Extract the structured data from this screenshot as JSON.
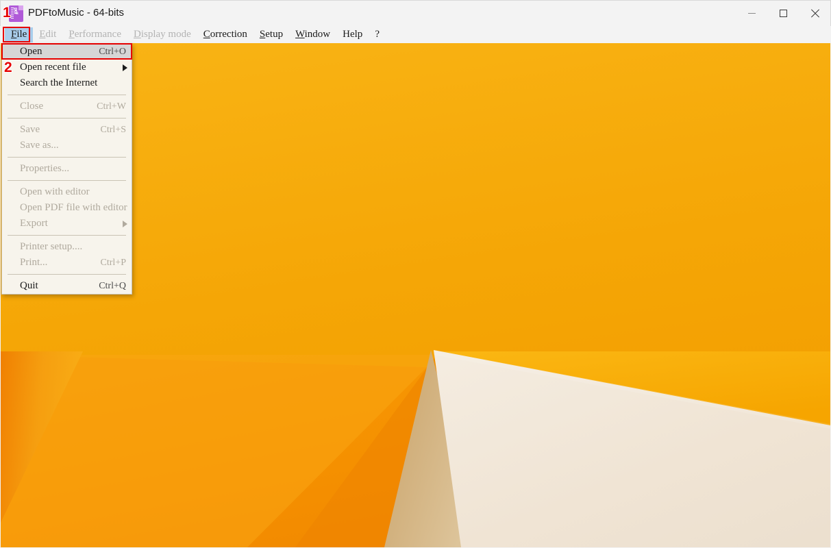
{
  "window": {
    "title": "PDFtoMusic - 64-bits",
    "app_icon": "pdf-document-icon",
    "icon_text": "pdf",
    "controls": {
      "minimize": "minimize-icon",
      "maximize": "maximize-icon",
      "close": "close-icon"
    }
  },
  "menubar": {
    "items": [
      {
        "label": "File",
        "mnemonic": "F",
        "disabled": false,
        "active": true
      },
      {
        "label": "Edit",
        "mnemonic": "E",
        "disabled": true,
        "active": false
      },
      {
        "label": "Performance",
        "mnemonic": "P",
        "disabled": true,
        "active": false
      },
      {
        "label": "Display mode",
        "mnemonic": "D",
        "disabled": true,
        "active": false
      },
      {
        "label": "Correction",
        "mnemonic": "C",
        "disabled": false,
        "active": false
      },
      {
        "label": "Setup",
        "mnemonic": "S",
        "disabled": false,
        "active": false
      },
      {
        "label": "Window",
        "mnemonic": "W",
        "disabled": false,
        "active": false
      },
      {
        "label": "Help",
        "mnemonic": "",
        "disabled": false,
        "active": false
      },
      {
        "label": "?",
        "mnemonic": "",
        "disabled": false,
        "active": false
      }
    ]
  },
  "file_menu": {
    "rows": [
      {
        "kind": "item",
        "label": "Open",
        "accel": "Ctrl+O",
        "disabled": false,
        "submenu": false,
        "highlighted": true
      },
      {
        "kind": "item",
        "label": "Open recent file",
        "accel": "",
        "disabled": false,
        "submenu": true,
        "highlighted": false
      },
      {
        "kind": "item",
        "label": "Search the Internet",
        "accel": "",
        "disabled": false,
        "submenu": false,
        "highlighted": false
      },
      {
        "kind": "sep"
      },
      {
        "kind": "item",
        "label": "Close",
        "accel": "Ctrl+W",
        "disabled": true,
        "submenu": false,
        "highlighted": false
      },
      {
        "kind": "sep"
      },
      {
        "kind": "item",
        "label": "Save",
        "accel": "Ctrl+S",
        "disabled": true,
        "submenu": false,
        "highlighted": false
      },
      {
        "kind": "item",
        "label": "Save as...",
        "accel": "",
        "disabled": true,
        "submenu": false,
        "highlighted": false
      },
      {
        "kind": "sep"
      },
      {
        "kind": "item",
        "label": "Properties...",
        "accel": "",
        "disabled": true,
        "submenu": false,
        "highlighted": false
      },
      {
        "kind": "sep"
      },
      {
        "kind": "item",
        "label": "Open with editor",
        "accel": "",
        "disabled": true,
        "submenu": false,
        "highlighted": false
      },
      {
        "kind": "item",
        "label": "Open PDF file with editor",
        "accel": "",
        "disabled": true,
        "submenu": false,
        "highlighted": false
      },
      {
        "kind": "item",
        "label": "Export",
        "accel": "",
        "disabled": true,
        "submenu": true,
        "highlighted": false
      },
      {
        "kind": "sep"
      },
      {
        "kind": "item",
        "label": "Printer setup....",
        "accel": "",
        "disabled": true,
        "submenu": false,
        "highlighted": false
      },
      {
        "kind": "item",
        "label": "Print...",
        "accel": "Ctrl+P",
        "disabled": true,
        "submenu": false,
        "highlighted": false
      },
      {
        "kind": "sep"
      },
      {
        "kind": "item",
        "label": "Quit",
        "accel": "Ctrl+Q",
        "disabled": false,
        "submenu": false,
        "highlighted": false
      }
    ]
  },
  "annotations": {
    "badges": [
      {
        "id": "badge-1",
        "text": "1"
      },
      {
        "id": "badge-2",
        "text": "2"
      }
    ],
    "highlight_color": "#e60000"
  },
  "colors": {
    "titlebar": "#f3f3f3",
    "menu_background": "#f7f4ec",
    "menu_highlight": "#d6d6d6",
    "menubar_active": "#a9cdeb",
    "wallpaper_amber": "#f5a800",
    "wallpaper_orange": "#f08a00",
    "wallpaper_cream": "#f0e4d4",
    "annotation_red": "#e60000"
  }
}
